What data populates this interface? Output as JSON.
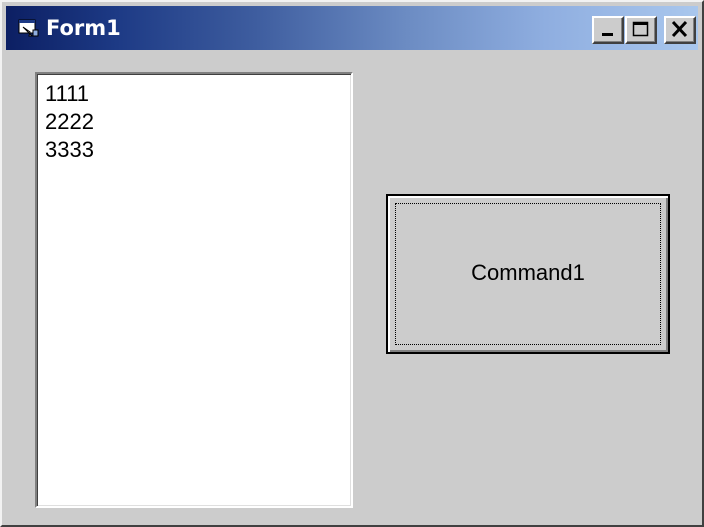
{
  "window": {
    "title": "Form1",
    "icon": "form-icon"
  },
  "titlebar_buttons": {
    "minimize_icon": "minimize-icon",
    "maximize_icon": "maximize-icon",
    "close_icon": "close-icon"
  },
  "listbox": {
    "items": [
      "1111",
      "2222",
      "3333"
    ]
  },
  "command_button": {
    "label": "Command1"
  },
  "colors": {
    "face": "#cccccc",
    "titlebar_start": "#0c1f63",
    "titlebar_end": "#a9c7ed",
    "title_text": "#ffffff"
  }
}
